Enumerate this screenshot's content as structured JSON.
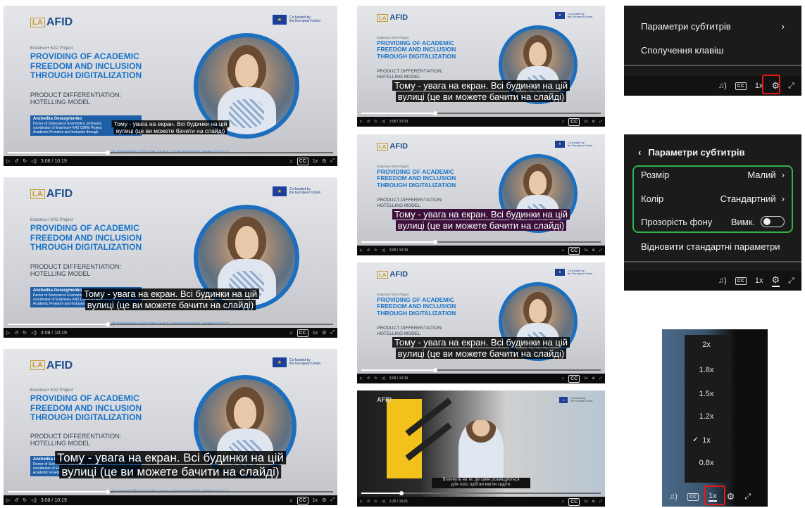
{
  "slide": {
    "logo": "AFID",
    "logo_mark": "LA",
    "eu_line1": "Co-funded by",
    "eu_line2": "the European Union",
    "project": "Erasmus+ KA2 Project",
    "title": [
      "PROVIDING OF ACADEMIC",
      "FREEDOM AND INCLUSION",
      "THROUGH DIGITALIZATION"
    ],
    "subtitle": [
      "PRODUCT DIFFERENTIATION:",
      "HOTELLING MODEL"
    ],
    "speaker_name": "Anzhelika Gerasymenko",
    "speaker_desc": [
      "Doctor of Sciences in Economics, professor,",
      "coordinator of Erasmus+ KA2 CBHE Project",
      "Academic Freedom and Inclusion through"
    ],
    "university": "ДЕРЖАВНИЙ ТОРГОВЕЛЬНО-ЕКОНОМІЧНИЙ УНІВЕРСИТЕТ"
  },
  "caption": {
    "line1": "Тому - увага на екран. Всі будинки на цій",
    "line2": "вулиці (це ви можете бачити на слайді)"
  },
  "office_caption": {
    "line1": "Вплинуть на те, де саме розміщуються",
    "line2": "для того, щоб ви могли сидіти."
  },
  "controls": {
    "time": "3:08 / 10:19",
    "time_alt": "1:26 / 10:21",
    "speed": "1x"
  },
  "settings_menu": {
    "subtitle_params": "Параметри субтитрів",
    "shortcuts": "Сполучення клавіш"
  },
  "subtitle_menu": {
    "header": "Параметри субтитрів",
    "size_label": "Розмір",
    "size_value": "Малий",
    "color_label": "Колір",
    "color_value": "Стандартний",
    "opacity_label": "Прозорість фону",
    "opacity_value": "Вимк.",
    "reset": "Відновити стандартні параметри"
  },
  "speed_menu": {
    "options": [
      "2x",
      "1.8x",
      "1.5x",
      "1.2x",
      "1x",
      "0.8x"
    ],
    "selected": "1x"
  }
}
